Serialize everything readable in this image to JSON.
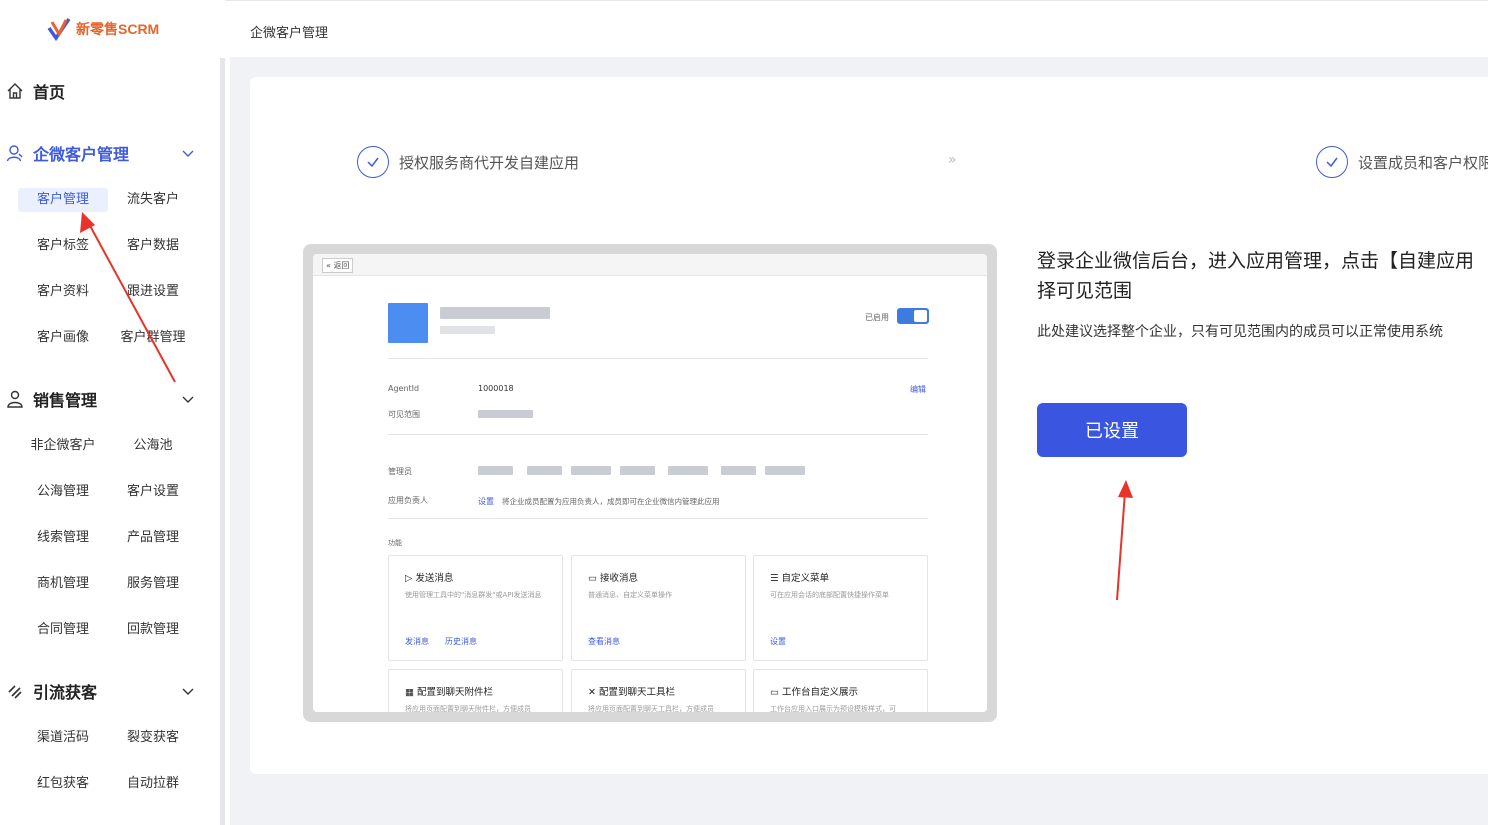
{
  "app": {
    "logo_text": "新零售SCRM"
  },
  "topbar": {
    "title": "企微客户管理"
  },
  "sidebar": {
    "home": "首页",
    "groups": [
      {
        "label": "企微客户管理",
        "items": [
          "客户管理",
          "流失客户",
          "客户标签",
          "客户数据",
          "客户资料",
          "跟进设置",
          "客户画像",
          "客户群管理"
        ]
      },
      {
        "label": "销售管理",
        "items": [
          "非企微客户",
          "公海池",
          "公海管理",
          "客户设置",
          "线索管理",
          "产品管理",
          "商机管理",
          "服务管理",
          "合同管理",
          "回款管理"
        ]
      },
      {
        "label": "引流获客",
        "items": [
          "渠道活码",
          "裂变获客",
          "红包获客",
          "自动拉群"
        ]
      }
    ]
  },
  "steps": [
    {
      "label": "授权服务商代开发自建应用"
    },
    {
      "label": "设置成员和客户权限"
    }
  ],
  "step_separator": "»",
  "mock": {
    "back": "« 返回",
    "enabled": "已启用",
    "agentid_label": "AgentId",
    "agentid_value": "1000018",
    "edit": "编辑",
    "visible_label": "可见范围",
    "admin_label": "管理员",
    "owner_label": "应用负责人",
    "owner_link": "设置",
    "owner_desc": "将企业成员配置为应用负责人，成员即可在企业微信内管理此应用",
    "func_label": "功能",
    "funcs": [
      {
        "title": "发送消息",
        "desc": "使用管理工具中的\"消息群发\"或API发送消息",
        "links": [
          "发消息",
          "历史消息"
        ]
      },
      {
        "title": "接收消息",
        "desc": "普通消息、自定义菜单操作",
        "links": [
          "查看消息"
        ]
      },
      {
        "title": "自定义菜单",
        "desc": "可在应用会话的底部配置快捷操作菜单",
        "links": [
          "设置"
        ]
      },
      {
        "title": "配置到聊天附件栏",
        "desc": "将应用页面配置到聊天附件栏，方便成员",
        "links": []
      },
      {
        "title": "配置到聊天工具栏",
        "desc": "将应用页面配置到聊天工具栏，方便成员",
        "links": []
      },
      {
        "title": "工作台自定义展示",
        "desc": "工作台应用入口展示为预设模板样式，可",
        "links": []
      }
    ]
  },
  "description": {
    "title_line1": "登录企业微信后台，进入应用管理，点击【自建应用",
    "title_line2": "择可见范围",
    "subtitle": "此处建议选择整个企业，只有可见范围内的成员可以正常使用系统"
  },
  "set_button": "已设置",
  "colors": {
    "accent": "#3e5bde",
    "button": "#3a56e0",
    "arrow": "#e8322a"
  }
}
